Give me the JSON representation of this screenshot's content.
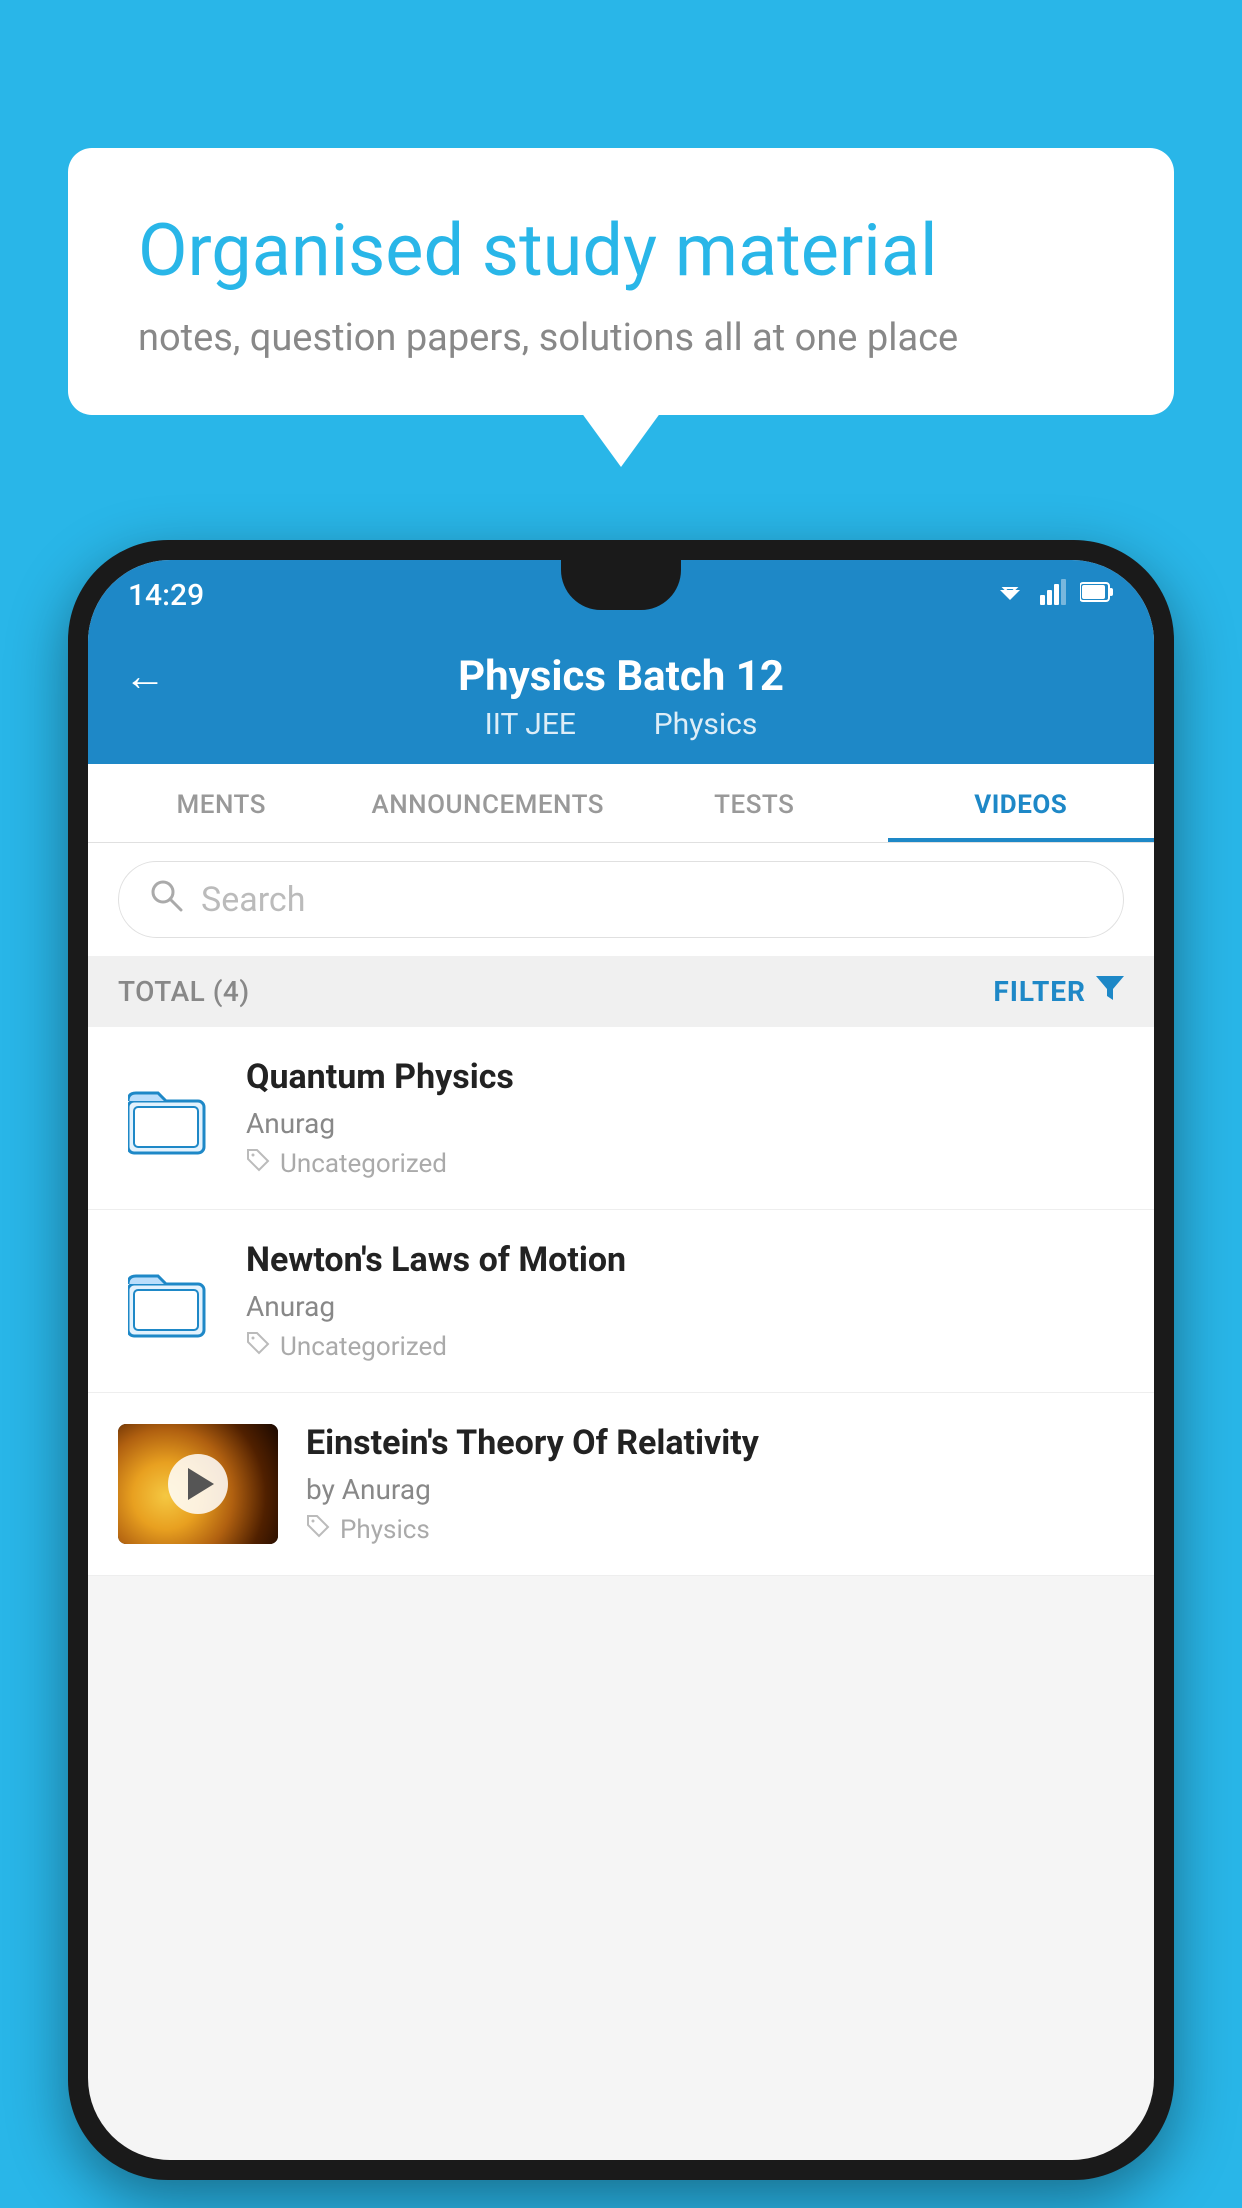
{
  "background_color": "#29B6E8",
  "speech_bubble": {
    "title": "Organised study material",
    "subtitle": "notes, question papers, solutions all at one place"
  },
  "phone": {
    "status_bar": {
      "time": "14:29",
      "wifi": "▼",
      "signal": "▲",
      "battery": "█"
    },
    "header": {
      "back_label": "←",
      "title": "Physics Batch 12",
      "subtitle_parts": [
        "IIT JEE",
        "Physics"
      ]
    },
    "tabs": [
      {
        "label": "MENTS",
        "active": false
      },
      {
        "label": "ANNOUNCEMENTS",
        "active": false
      },
      {
        "label": "TESTS",
        "active": false
      },
      {
        "label": "VIDEOS",
        "active": true
      }
    ],
    "search": {
      "placeholder": "Search"
    },
    "filter_row": {
      "total_label": "TOTAL (4)",
      "filter_label": "FILTER"
    },
    "videos": [
      {
        "id": 1,
        "title": "Quantum Physics",
        "author": "Anurag",
        "tag": "Uncategorized",
        "has_thumbnail": false
      },
      {
        "id": 2,
        "title": "Newton's Laws of Motion",
        "author": "Anurag",
        "tag": "Uncategorized",
        "has_thumbnail": false
      },
      {
        "id": 3,
        "title": "Einstein's Theory Of Relativity",
        "author": "by Anurag",
        "tag": "Physics",
        "has_thumbnail": true
      }
    ]
  }
}
